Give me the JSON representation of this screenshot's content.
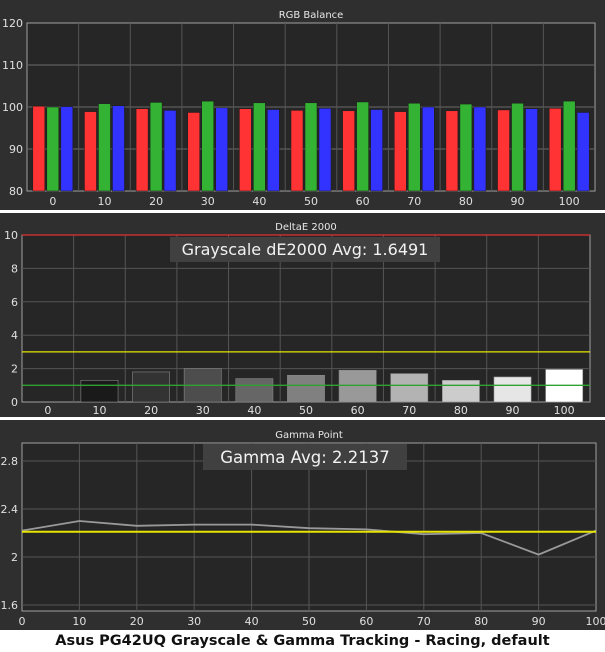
{
  "caption": "Asus PG42UQ Grayscale & Gamma Tracking - Racing, default",
  "chart_data": [
    {
      "type": "bar",
      "title": "RGB Balance",
      "categories": [
        "0",
        "10",
        "20",
        "30",
        "40",
        "50",
        "60",
        "70",
        "80",
        "90",
        "100"
      ],
      "ylim": [
        80,
        120
      ],
      "yticks": [
        80,
        90,
        100,
        110,
        120
      ],
      "grid": true,
      "series": [
        {
          "color": "#ff3333",
          "values": [
            100.2,
            98.9,
            99.6,
            98.7,
            99.6,
            99.2,
            99.1,
            98.9,
            99.1,
            99.3,
            99.7
          ]
        },
        {
          "color": "#33b233",
          "values": [
            100.0,
            100.8,
            101.1,
            101.4,
            101.0,
            101.0,
            101.2,
            100.9,
            100.7,
            100.9,
            101.4
          ]
        },
        {
          "color": "#3333ff",
          "values": [
            100.1,
            100.3,
            99.2,
            99.8,
            99.4,
            99.7,
            99.4,
            100.0,
            100.0,
            99.6,
            98.7
          ]
        }
      ]
    },
    {
      "type": "bar",
      "title": "DeltaE 2000",
      "annotation": "Grayscale dE2000 Avg: 1.6491",
      "categories": [
        "0",
        "10",
        "20",
        "30",
        "40",
        "50",
        "60",
        "70",
        "80",
        "90",
        "100"
      ],
      "values": [
        0.0,
        1.3,
        1.8,
        2.0,
        1.4,
        1.6,
        1.9,
        1.7,
        1.3,
        1.5,
        1.95
      ],
      "ylim": [
        0,
        10
      ],
      "yticks": [
        0,
        2,
        4,
        6,
        8,
        10
      ],
      "reference_lines": [
        {
          "value": 10,
          "color": "#e03030"
        },
        {
          "value": 3,
          "color": "#e6e600"
        },
        {
          "value": 1,
          "color": "#30a030"
        }
      ],
      "grid": true
    },
    {
      "type": "line",
      "title": "Gamma Point",
      "annotation": "Gamma Avg: 2.2137",
      "x": [
        0,
        10,
        20,
        30,
        40,
        50,
        60,
        70,
        80,
        90,
        100
      ],
      "xticks": [
        0,
        10,
        20,
        30,
        40,
        50,
        60,
        70,
        80,
        90,
        100
      ],
      "series": [
        {
          "color": "#999999",
          "values": [
            2.22,
            2.3,
            2.26,
            2.27,
            2.27,
            2.24,
            2.23,
            2.19,
            2.2,
            2.02,
            2.22
          ]
        },
        {
          "color": "#e6e600",
          "values": [
            2.21,
            2.21,
            2.21,
            2.21,
            2.21,
            2.21,
            2.21,
            2.21,
            2.21,
            2.21,
            2.21
          ]
        }
      ],
      "ylim": [
        1.55,
        2.95
      ],
      "yticks": [
        1.6,
        2,
        2.4,
        2.8
      ],
      "grid": true
    }
  ]
}
